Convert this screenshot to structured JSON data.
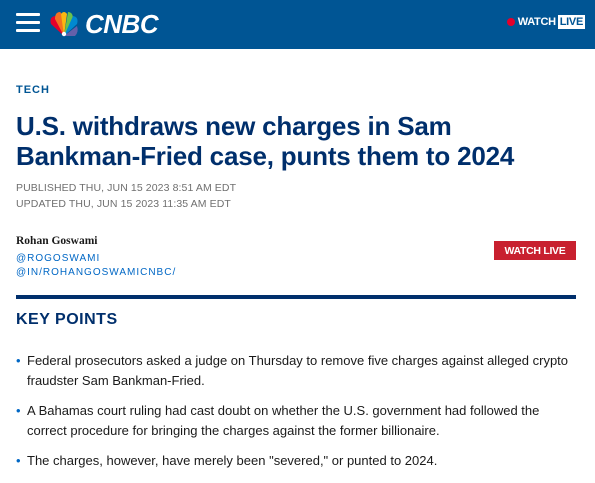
{
  "header": {
    "logo_text": "CNBC",
    "watch_label": "WATCH",
    "live_label": "LIVE"
  },
  "article": {
    "section": "TECH",
    "headline": "U.S. withdraws new charges in Sam Bankman-Fried case, punts them to 2024",
    "published": "PUBLISHED THU, JUN 15 2023 8:51 AM EDT",
    "updated": "UPDATED THU, JUN 15 2023 11:35 AM EDT",
    "author": "Rohan Goswami",
    "author_handles": [
      "@ROGOSWAMI",
      "@IN/ROHANGOSWAMICNBC/"
    ],
    "watch_live_button": "WATCH LIVE"
  },
  "key_points": {
    "title": "KEY POINTS",
    "items": [
      "Federal prosecutors asked a judge on Thursday to remove five charges against alleged crypto fraudster Sam Bankman-Fried.",
      "A Bahamas court ruling had cast doubt on whether the U.S. government had followed the correct procedure for bringing the charges against the former billionaire.",
      "The charges, however, have merely been \"severed,\" or punted to 2024."
    ]
  },
  "colors": {
    "header_blue": "#005594",
    "headline_navy": "#002f6c",
    "link_blue": "#0067c5",
    "live_red": "#c8202f"
  },
  "icons": [
    "hamburger-menu-icon",
    "peacock-logo-icon",
    "live-dot-icon"
  ]
}
